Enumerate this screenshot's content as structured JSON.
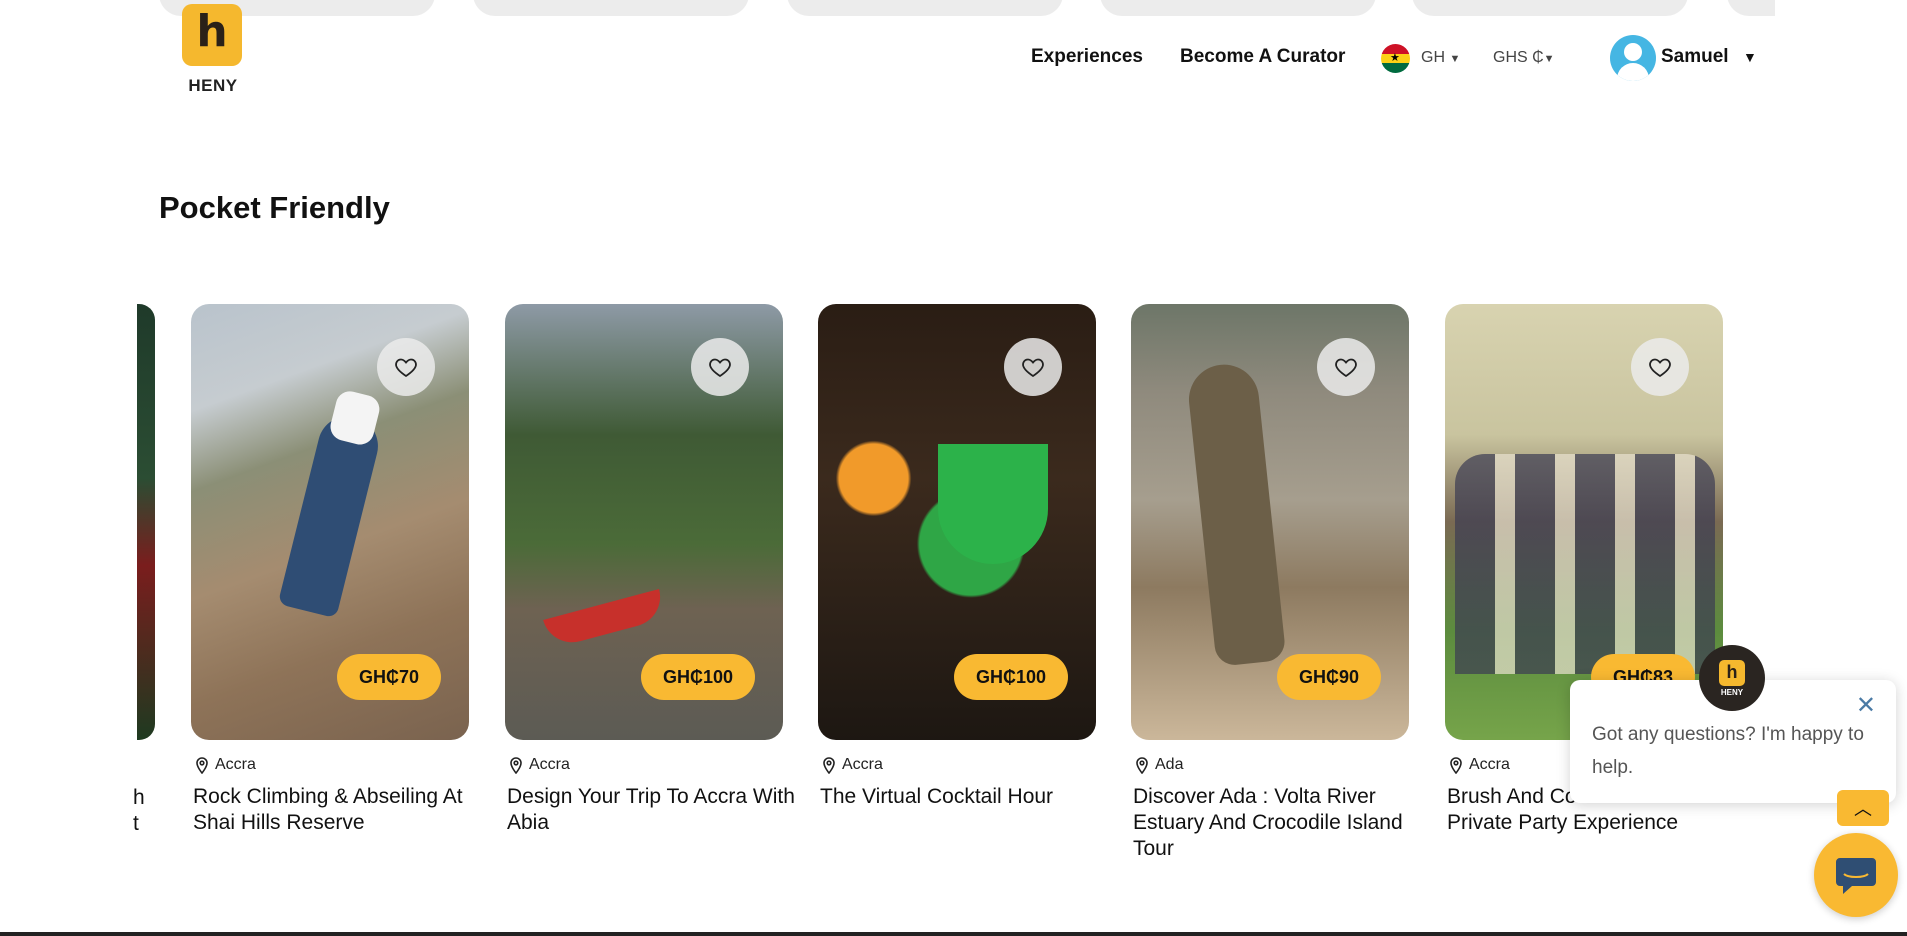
{
  "brand": {
    "logo_letter": "h",
    "name": "HENY",
    "accent": "#f9b932"
  },
  "nav": {
    "experiences": "Experiences",
    "become_curator": "Become A Curator",
    "country": "GH",
    "currency": "GHS ₵",
    "user": "Samuel"
  },
  "section": {
    "title": "Pocket Friendly"
  },
  "edge_card": {
    "line1": "h",
    "line2": "t"
  },
  "cards": [
    {
      "price": "GH₵70",
      "location": "Accra",
      "title": "Rock Climbing & Abseiling At Shai Hills Reserve"
    },
    {
      "price": "GH₵100",
      "location": "Accra",
      "title": "Design Your Trip To Accra With Abia"
    },
    {
      "price": "GH₵100",
      "location": "Accra",
      "title": "The Virtual Cocktail Hour"
    },
    {
      "price": "GH₵90",
      "location": "Ada",
      "title": "Discover Ada : Volta River Estuary And Crocodile Island Tour"
    },
    {
      "price": "GH₵83",
      "location": "Accra",
      "title": "Brush And Cocktail Private Party Experience"
    }
  ],
  "chat": {
    "message": "Got any questions? I'm happy to help.",
    "badge_letter": "h",
    "badge_name": "HENY"
  }
}
